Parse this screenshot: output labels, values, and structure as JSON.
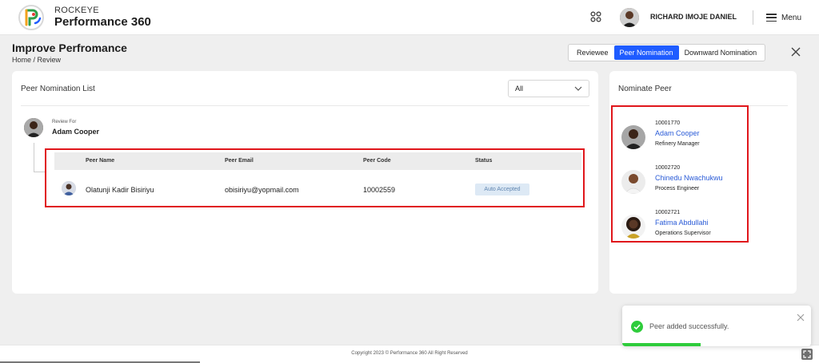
{
  "header": {
    "brand_top": "ROCKEYE",
    "brand_name": "Performance 360",
    "user_name": "RICHARD IMOJE DANIEL",
    "menu_label": "Menu"
  },
  "page": {
    "title": "Improve Perfromance",
    "breadcrumb": "Home  /  Review"
  },
  "tabs": [
    {
      "label": "Reviewee",
      "active": false
    },
    {
      "label": "Peer Nomination",
      "active": true
    },
    {
      "label": "Downward Nomination",
      "active": false
    }
  ],
  "list_card": {
    "title": "Peer Nomination List",
    "filter_value": "All",
    "review_for_label": "Review For",
    "review_for_name": "Adam Cooper",
    "columns": [
      "Peer Name",
      "Peer Email",
      "Peer Code",
      "Status"
    ],
    "rows": [
      {
        "name": "Olatunji Kadir Bisiriyu",
        "email": "obisiriyu@yopmail.com",
        "code": "10002559",
        "status": "Auto Accepted"
      }
    ]
  },
  "nominate_card": {
    "title": "Nominate Peer",
    "peers": [
      {
        "code": "10001770",
        "name": "Adam Cooper",
        "role": "Refinery Manager"
      },
      {
        "code": "10002720",
        "name": "Chinedu Nwachukwu",
        "role": "Process Engineer"
      },
      {
        "code": "10002721",
        "name": "Fatima Abdullahi",
        "role": "Operations Supervisor"
      }
    ]
  },
  "toast": {
    "message": "Peer added successfully."
  },
  "footer": {
    "copyright": "Copyright 2023 © Performance 360 All Right Reserved"
  },
  "colors": {
    "primary": "#1f5cff",
    "link": "#2a5bd7",
    "highlight": "#e0161b",
    "success": "#2ecc3b"
  }
}
